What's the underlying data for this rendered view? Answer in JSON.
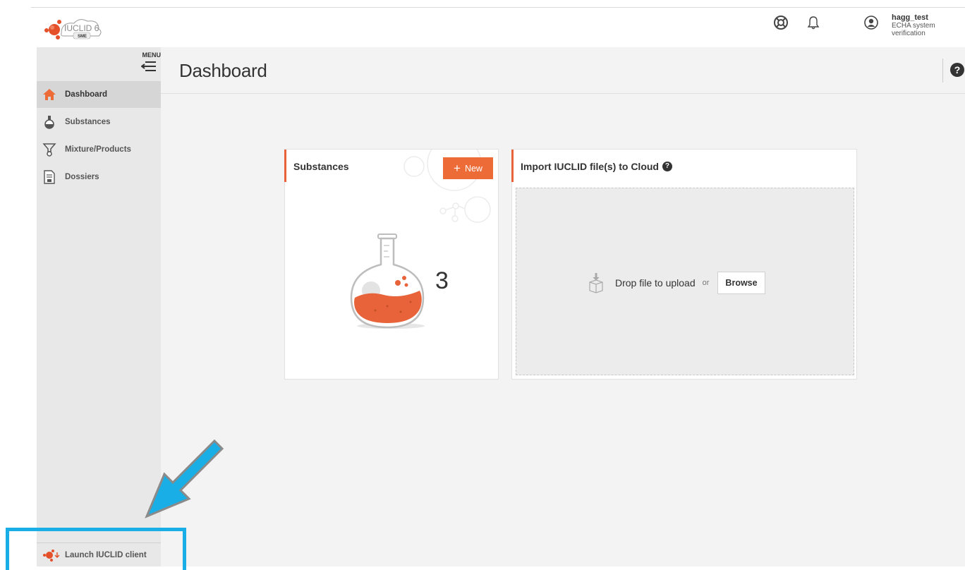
{
  "header": {
    "logo_text": "IUCLID 6",
    "logo_sub": "SME",
    "icons": [
      "support-icon",
      "bell-icon",
      "user-icon"
    ],
    "user_name": "hagg_test",
    "user_org_line1": "ECHA system",
    "user_org_line2": "verification"
  },
  "sidebar": {
    "menu_label": "MENU",
    "items": [
      {
        "label": "Dashboard",
        "icon": "home-icon",
        "active": true
      },
      {
        "label": "Substances",
        "icon": "flask-icon",
        "active": false
      },
      {
        "label": "Mixture/Products",
        "icon": "mixture-icon",
        "active": false
      },
      {
        "label": "Dossiers",
        "icon": "dossier-icon",
        "active": false
      }
    ],
    "launch_label": "Launch IUCLID client"
  },
  "main": {
    "title": "Dashboard",
    "help_symbol": "?",
    "substances_card": {
      "title": "Substances",
      "new_button": "New",
      "new_button_symbol": "+",
      "count": "3"
    },
    "import_card": {
      "title": "Import IUCLID file(s) to Cloud",
      "help_symbol": "?",
      "drop_text": "Drop file to upload",
      "or_text": "or",
      "browse_button": "Browse"
    }
  },
  "colors": {
    "accent_orange": "#ed6b37",
    "highlight_blue": "#19aee5",
    "sidebar_bg": "#e8e8e8",
    "main_bg": "#f3f3f3"
  }
}
